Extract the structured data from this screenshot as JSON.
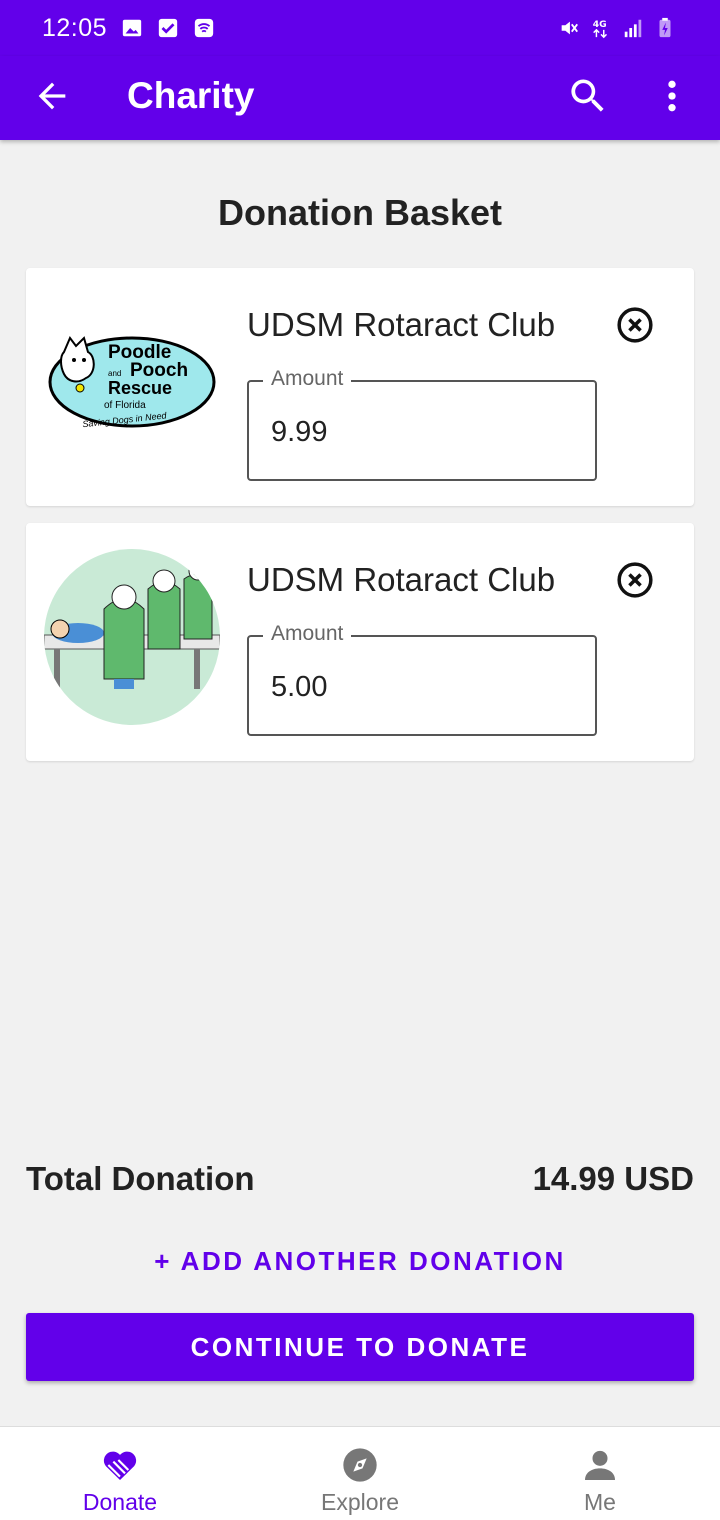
{
  "status_bar": {
    "time": "12:05",
    "icons": [
      "image-icon",
      "check-box-icon",
      "wifi-calling-icon"
    ],
    "right_icons": [
      "mute-icon",
      "4g-icon",
      "signal-icon",
      "battery-charging-icon"
    ]
  },
  "app_bar": {
    "title": "Charity",
    "back_icon": "arrow-back-icon",
    "search_icon": "search-icon",
    "more_icon": "more-vert-icon",
    "color": "#6200ea"
  },
  "page": {
    "title": "Donation Basket"
  },
  "donations": [
    {
      "name": "UDSM Rotaract Club",
      "amount_label": "Amount",
      "amount": "9.99",
      "logo_text": [
        "Poodle",
        "and",
        "Pooch",
        "Rescue",
        "of Florida",
        "Saving Dogs in Need"
      ]
    },
    {
      "name": "UDSM Rotaract Club",
      "amount_label": "Amount",
      "amount": "5.00"
    }
  ],
  "summary": {
    "total_label": "Total Donation",
    "total_value": "14.99 USD"
  },
  "actions": {
    "add_another": "+ ADD ANOTHER DONATION",
    "continue": "CONTINUE TO DONATE"
  },
  "bottom_nav": {
    "items": [
      {
        "label": "Donate",
        "icon": "heart-hand-icon",
        "active": true
      },
      {
        "label": "Explore",
        "icon": "compass-icon",
        "active": false
      },
      {
        "label": "Me",
        "icon": "person-icon",
        "active": false
      }
    ]
  }
}
